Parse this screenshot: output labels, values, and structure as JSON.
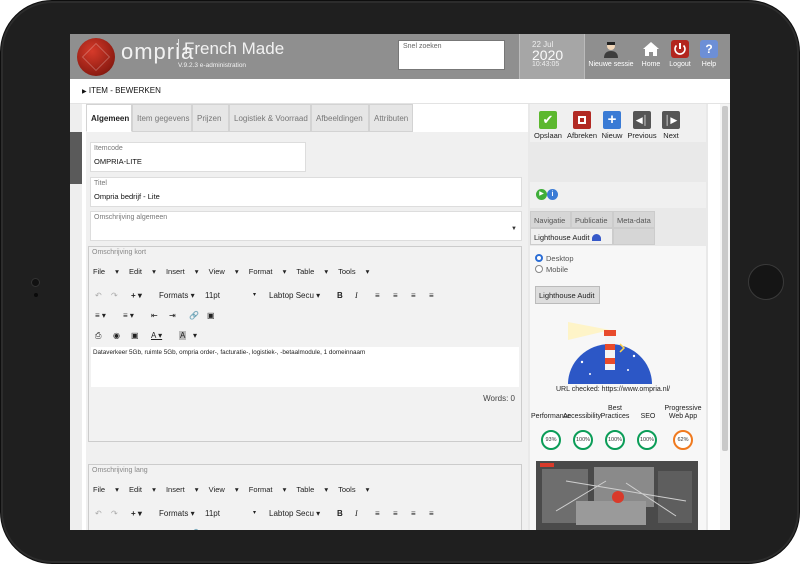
{
  "header": {
    "brand": "ompria",
    "brand_sub": "French Made",
    "version": "V.9.2.3 e-administration",
    "search_placeholder": "Snel zoeken",
    "date_day": "22 Jul",
    "date_year": "2020",
    "time": "10:43:05",
    "buttons": [
      {
        "label": "Nieuwe sessie",
        "icon": "user-icon"
      },
      {
        "label": "Home",
        "icon": "home-icon"
      },
      {
        "label": "Logout",
        "icon": "power-icon"
      },
      {
        "label": "Help",
        "icon": "help-icon"
      }
    ]
  },
  "breadcrumb": "ITEM - BEWERKEN",
  "tabs": [
    "Algemeen",
    "Item gegevens",
    "Prijzen",
    "Logistiek & Voorraad",
    "Afbeeldingen",
    "Attributen"
  ],
  "fields": {
    "itemcode_label": "Itemcode",
    "itemcode_value": "OMPRIA-LITE",
    "titel_label": "Titel",
    "titel_value": "Ompria bedrijf - Lite",
    "omschrijving_algemeen_label": "Omschrijving algemeen"
  },
  "editor_kort": {
    "label": "Omschrijving kort",
    "menu": [
      "File",
      "Edit",
      "Insert",
      "View",
      "Format",
      "Table",
      "Tools"
    ],
    "formats_label": "Formats",
    "font_size": "11pt",
    "font_family": "Labtop Secu",
    "content": "Dataverkeer 5Gb, ruimte 5Gb, ompria order-, facturatie-, logistiek-, -betaalmodule, 1 domeinnaam",
    "words": "Words: 0"
  },
  "editor_lang": {
    "label": "Omschrijving lang",
    "menu": [
      "File",
      "Edit",
      "Insert",
      "View",
      "Format",
      "Table",
      "Tools"
    ],
    "formats_label": "Formats",
    "font_size": "11pt",
    "font_family": "Labtop Secu"
  },
  "right_panel": {
    "actions": [
      {
        "label": "Opslaan",
        "color": "#5cb82f"
      },
      {
        "label": "Afbreken",
        "color": "#b22a24"
      },
      {
        "label": "Nieuw",
        "color": "#3a7bd5"
      },
      {
        "label": "Previous",
        "color": "#555555"
      },
      {
        "label": "Next",
        "color": "#555555"
      }
    ],
    "tabs": [
      "Navigatie",
      "Publicatie",
      "Meta-data",
      "Lighthouse Audit"
    ],
    "radio_desktop": "Desktop",
    "radio_mobile": "Mobile",
    "lighthouse_button": "Lighthouse Audit",
    "url_checked": "URL checked: https://www.ompria.nl/",
    "scores": [
      {
        "label": "Performance",
        "value": "93%",
        "color": "#0c9d58"
      },
      {
        "label": "Accessibility",
        "value": "100%",
        "color": "#0c9d58"
      },
      {
        "label": "Best Practices",
        "value": "100%",
        "color": "#0c9d58"
      },
      {
        "label": "SEO",
        "value": "100%",
        "color": "#0c9d58"
      },
      {
        "label": "Progressive Web App",
        "value": "62%",
        "color": "#f07a1f"
      }
    ]
  }
}
